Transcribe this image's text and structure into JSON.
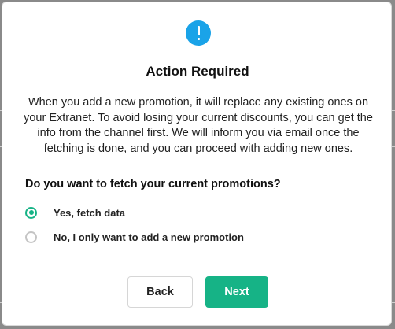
{
  "dialog": {
    "title": "Action Required",
    "icon": "alert-info-icon",
    "message": "When you add a new promotion, it will replace any existing ones on your Extranet. To avoid losing your current discounts, you can get the info from the channel first. We will inform you via email once the fetching is done, and you can proceed with adding new ones.",
    "question": "Do you want to fetch your current promotions?",
    "options": [
      {
        "label": "Yes, fetch data",
        "selected": true
      },
      {
        "label": "No, I only want to add a new promotion",
        "selected": false
      }
    ],
    "buttons": {
      "back": "Back",
      "next": "Next"
    }
  },
  "colors": {
    "accent": "#16b386",
    "info_icon": "#1aa3e8"
  }
}
